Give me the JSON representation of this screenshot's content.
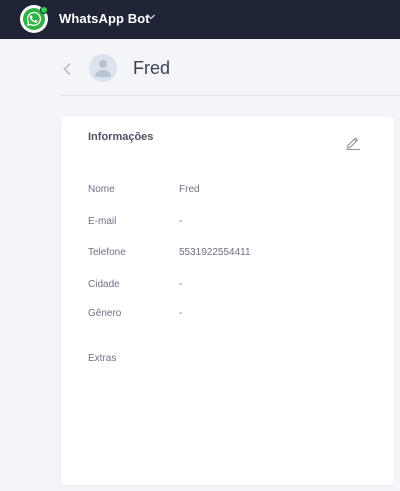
{
  "app": {
    "title": "WhatsApp Bot",
    "colors": {
      "topbar": "#1f2436",
      "brand": "#2fb344",
      "status": "#35d04b",
      "background": "#f4f5f8"
    }
  },
  "topbar": {
    "logo_icon": "whatsapp-icon",
    "dropdown_icon": "chevron-down-icon"
  },
  "header": {
    "back_icon": "chevron-left-icon",
    "avatar_icon": "user-icon",
    "contact_name": "Fred"
  },
  "card": {
    "title": "Informações",
    "edit_icon": "pencil-icon",
    "fields": [
      {
        "label": "Nome",
        "value": "Fred"
      },
      {
        "label": "E-mail",
        "value": "-"
      },
      {
        "label": "Telefone",
        "value": "5531922554411"
      },
      {
        "label": "Cidade",
        "value": "-"
      },
      {
        "label": "Gênero",
        "value": "-"
      }
    ],
    "extras_label": "Extras"
  }
}
